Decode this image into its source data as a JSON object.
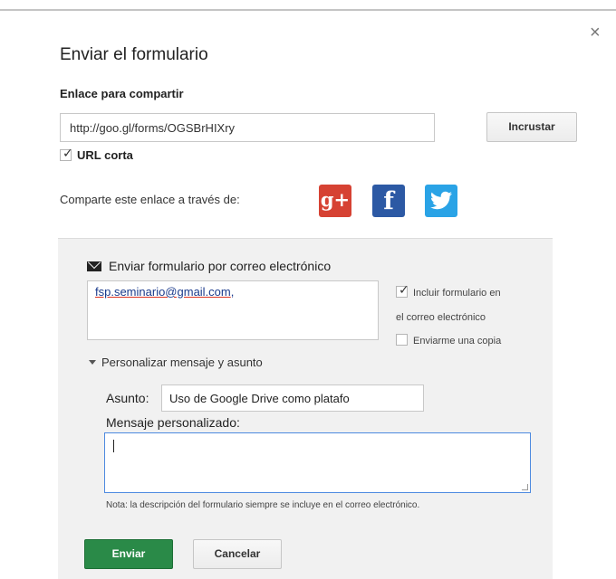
{
  "dialog": {
    "title": "Enviar el formulario",
    "close_label": "×"
  },
  "share": {
    "heading": "Enlace para compartir",
    "url_value": "http://goo.gl/forms/OGSBrHIXry",
    "embed_label": "Incrustar",
    "short_url_label": "URL corta",
    "short_url_checked": true,
    "share_via_label": "Comparte este enlace a través de:",
    "social_icons": [
      "google-plus-icon",
      "facebook-icon",
      "twitter-icon"
    ],
    "google_plus_glyph": "g+",
    "facebook_glyph": "f"
  },
  "email": {
    "heading": "Enviar formulario por correo electrónico",
    "recipients": "fsp.seminario@gmail.com",
    "recipients_suffix": ",",
    "include_form_label_1": "Incluir formulario en",
    "include_form_label_2": "el correo electrónico",
    "include_form_checked": true,
    "send_copy_label": "Enviarme una copia",
    "send_copy_checked": false,
    "customize_label": "Personalizar mensaje y asunto",
    "subject_label": "Asunto:",
    "subject_value": "Uso de Google Drive como platafo",
    "message_label": "Mensaje personalizado:",
    "message_value": "",
    "note": "Nota: la descripción del formulario siempre se incluye en el correo electrónico."
  },
  "actions": {
    "send_label": "Enviar",
    "cancel_label": "Cancelar"
  },
  "colors": {
    "send_button": "#2a8a48",
    "google_plus": "#d64233",
    "facebook": "#2c59a4",
    "twitter": "#2aa3e6",
    "focus_border": "#4d8ae0"
  }
}
